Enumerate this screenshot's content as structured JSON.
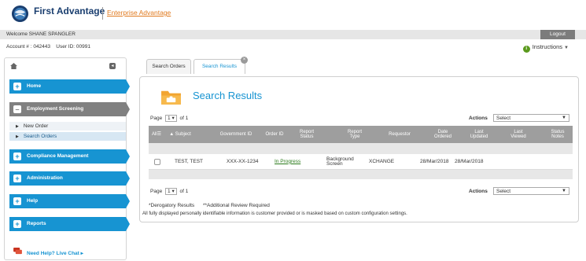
{
  "header": {
    "brand": "First Advantage",
    "subbrand": "Enterprise Advantage"
  },
  "welcome": {
    "text": "Welcome SHANE SPANGLER",
    "logout": "Logout"
  },
  "account": {
    "account_label": "Account # : 042443",
    "user_label": "User ID: 00991",
    "instructions": "Instructions"
  },
  "sidebar": {
    "items": [
      {
        "label": "Home"
      },
      {
        "label": "Employment Screening"
      },
      {
        "label": "Compliance Management"
      },
      {
        "label": "Administration"
      },
      {
        "label": "Help"
      },
      {
        "label": "Reports"
      }
    ],
    "sub_items": [
      {
        "label": "New Order"
      },
      {
        "label": "Search Orders"
      }
    ],
    "help_chat": "Need Help? Live Chat ▸"
  },
  "tabs": [
    {
      "label": "Search Orders"
    },
    {
      "label": "Search Results"
    }
  ],
  "results": {
    "title": "Search Results",
    "page_label": "Page",
    "page_value": "1",
    "page_of": "of 1",
    "actions_label": "Actions",
    "actions_value": "Select",
    "columns": {
      "all": "All",
      "subject": "▲ Subject",
      "gov_id": "Government ID",
      "order_id": "Order ID",
      "report_status": "Report Status",
      "report_type": "Report Type",
      "requestor": "Requestor",
      "date_ordered": "Date Ordered",
      "last_updated": "Last Updated",
      "last_viewed": "Last Viewed",
      "status_notes": "Status Notes"
    },
    "rows": [
      {
        "subject": "TEST, TEST",
        "gov_id": "XXX-XX-1234",
        "order_id": "In Progress",
        "report_type": "Background Screen",
        "requestor": "XCHANGE",
        "date_ordered": "28/Mar/2018",
        "last_updated": "28/Mar/2018",
        "last_viewed": "",
        "status_notes": ""
      }
    ],
    "footnote": "*Derogatory Results      **Additional Review Required",
    "disclaimer": "All fully displayed personally identifiable information is customer provided or is masked based on custom configuration settings."
  },
  "colors": {
    "nav_blue": "#1794d2",
    "nav_active": "#808080",
    "brand_navy": "#1a3e6f",
    "brand_orange": "#e07a1f",
    "link_green": "#2a7a1a"
  },
  "icons": [
    "globe-logo-icon",
    "home-icon",
    "collapse-icon",
    "plus-icon",
    "minus-icon",
    "chat-icon",
    "info-icon",
    "folder-icon",
    "close-icon",
    "chevron-down-icon"
  ]
}
